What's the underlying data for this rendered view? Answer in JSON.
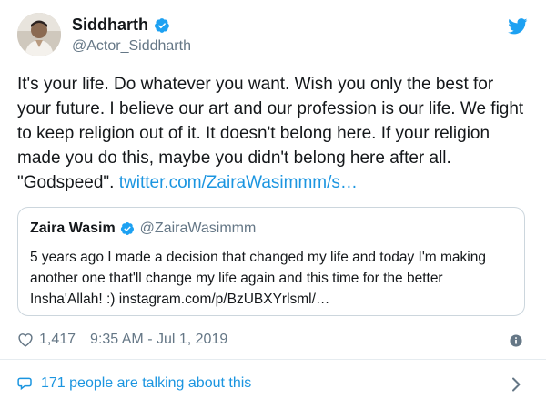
{
  "author": {
    "display_name": "Siddharth",
    "handle": "@Actor_Siddharth"
  },
  "tweet": {
    "text": "It's your life. Do whatever you want. Wish you only the best for your future. I believe our art and our profession is our life. We fight to keep religion out of it. It doesn't belong here. If your religion made you do this, maybe you didn't belong here after all. \"Godspeed\".",
    "link_text": "twitter.com/ZairaWasimmm/s…"
  },
  "quoted_tweet": {
    "display_name": "Zaira Wasim",
    "handle": "@ZairaWasimmm",
    "text": "5 years ago I made a decision that changed my life and today I'm making another one that'll change my life again and this time for the better Insha'Allah! :) instagram.com/p/BzUBXYrlsml/…"
  },
  "meta": {
    "likes": "1,417",
    "timestamp": "9:35 AM - Jul 1, 2019"
  },
  "conversation": {
    "label": "171 people are talking about this"
  },
  "colors": {
    "accent": "#1da1f2",
    "link": "#1b95e0",
    "secondary_text": "#657786",
    "border": "#ccd6dd"
  },
  "icons": [
    "verified-badge-icon",
    "twitter-bird-icon",
    "heart-icon",
    "info-icon",
    "comment-bubble-icon",
    "chevron-right-icon"
  ]
}
